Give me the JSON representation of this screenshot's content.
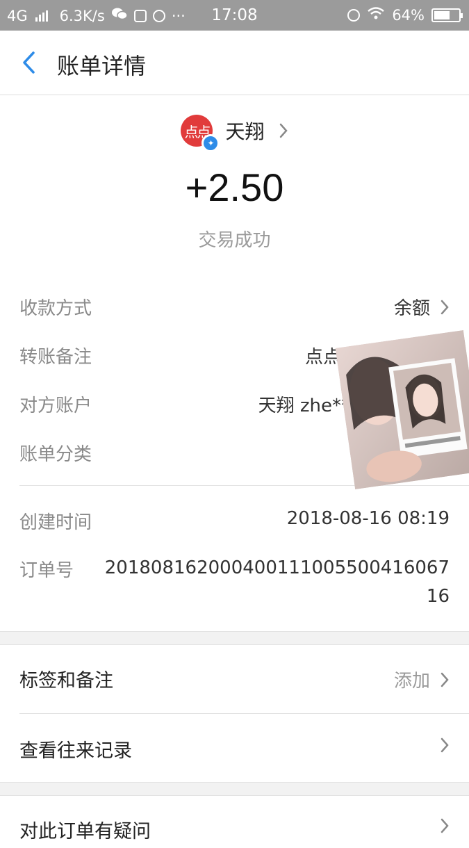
{
  "status_bar": {
    "network": "4G",
    "speed": "6.3K/s",
    "dots": "···",
    "time": "17:08",
    "battery": "64%",
    "battery_level": 0.64,
    "icons": [
      "signal-icon",
      "wechat-icon",
      "app-icon",
      "alarm-icon",
      "alarm-icon",
      "wifi-icon",
      "battery-icon"
    ]
  },
  "header": {
    "title": "账单详情",
    "back_icon": "chevron-left-icon"
  },
  "summary": {
    "avatar_text": "点点",
    "payee_name": "天翔",
    "amount": "+2.50",
    "status": "交易成功"
  },
  "details": [
    {
      "label": "收款方式",
      "value": "余额"
    },
    {
      "label": "转账备注",
      "value": "点点手机操作工资"
    },
    {
      "label": "对方账户",
      "value": "天翔 zhe***"
    },
    {
      "label": "账单分类",
      "value": ""
    }
  ],
  "meta": {
    "created_label": "创建时间",
    "created_value": "2018-08-16 08:19",
    "order_label": "订单号",
    "order_value": "2018081620004001110055004160​6716"
  },
  "actions": {
    "tags_label": "标签和备注",
    "tags_value": "添加",
    "history_label": "查看往来记录",
    "question_label": "对此订单有疑问"
  },
  "colors": {
    "accent": "#2e8ce8",
    "avatar": "#e13b3b",
    "status_bar": "#9b9b9b"
  }
}
